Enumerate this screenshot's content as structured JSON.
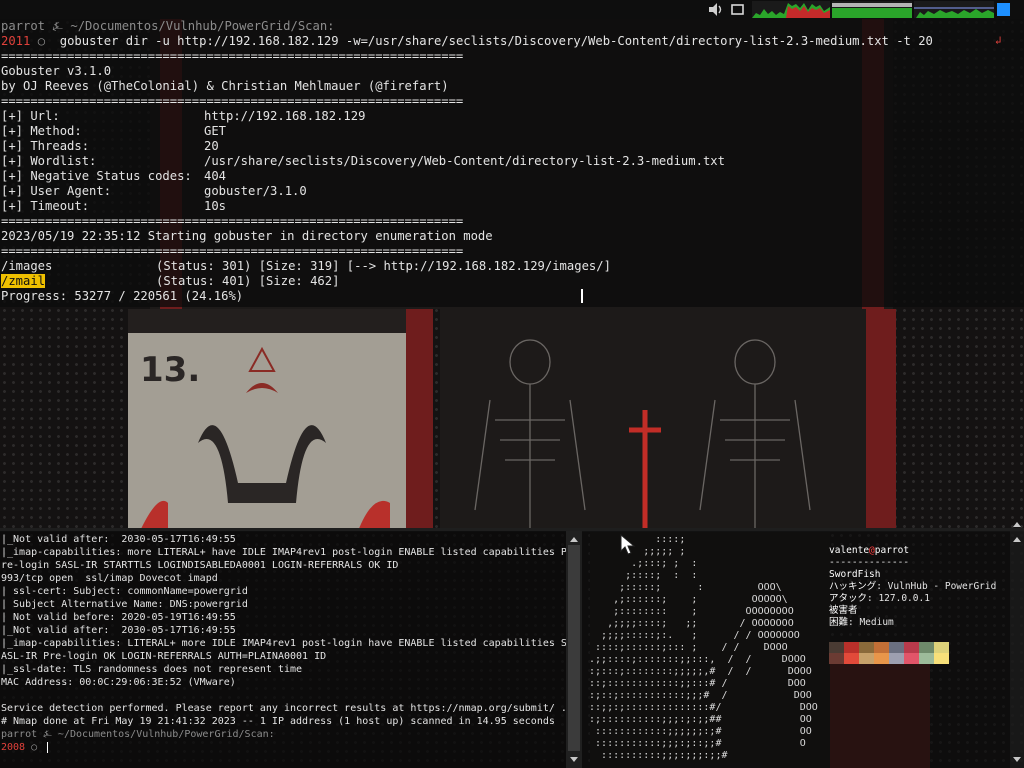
{
  "top_terminal": {
    "prompt_user": "parrot",
    "prompt_symbol": "⍼",
    "prompt_path": "~/Documentos/Vulnhub/PowerGrid/Scan:",
    "command_number": "2011",
    "command_status": "○",
    "command": "gobuster dir -u http://192.168.182.129 -w=/usr/share/seclists/Discovery/Web-Content/directory-list-2.3-medium.txt -t 20",
    "return_marker": "↲",
    "separator": "===============================================================",
    "banner_version": "Gobuster v3.1.0",
    "banner_authors": "by OJ Reeves (@TheColonial) & Christian Mehlmauer (@firefart)",
    "config": [
      {
        "key": "[+] Url:",
        "value": "http://192.168.182.129"
      },
      {
        "key": "[+] Method:",
        "value": "GET"
      },
      {
        "key": "[+] Threads:",
        "value": "20"
      },
      {
        "key": "[+] Wordlist:",
        "value": "/usr/share/seclists/Discovery/Web-Content/directory-list-2.3-medium.txt"
      },
      {
        "key": "[+] Negative Status codes:",
        "value": "404"
      },
      {
        "key": "[+] User Agent:",
        "value": "gobuster/3.1.0"
      },
      {
        "key": "[+] Timeout:",
        "value": "10s"
      }
    ],
    "start_line": "2023/05/19 22:35:12 Starting gobuster in directory enumeration mode",
    "results": [
      {
        "path": "/images",
        "info": "(Status: 301) [Size: 319] [--> http://192.168.182.129/images/]"
      },
      {
        "path": "/zmail",
        "info": "(Status: 401) [Size: 462]"
      }
    ],
    "progress": "Progress: 53277 / 220561 (24.16%)"
  },
  "bottom_left_terminal": {
    "lines": [
      "|_Not valid after:  2030-05-17T16:49:55",
      "|_imap-capabilities: more LITERAL+ have IDLE IMAP4rev1 post-login ENABLE listed capabilities P",
      "re-login SASL-IR STARTTLS LOGINDISABLEDA0001 LOGIN-REFERRALS OK ID",
      "993/tcp open  ssl/imap Dovecot imapd",
      "| ssl-cert: Subject: commonName=powergrid",
      "| Subject Alternative Name: DNS:powergrid",
      "| Not valid before: 2020-05-19T16:49:55",
      "|_Not valid after:  2030-05-17T16:49:55",
      "|_imap-capabilities: LITERAL+ more IDLE IMAP4rev1 post-login have ENABLE listed capabilities S",
      "ASL-IR Pre-login OK LOGIN-REFERRALS AUTH=PLAINA0001 ID",
      "|_ssl-date: TLS randomness does not represent time",
      "MAC Address: 00:0C:29:06:3E:52 (VMware)",
      "",
      "Service detection performed. Please report any incorrect results at https://nmap.org/submit/ .",
      "# Nmap done at Fri May 19 21:41:32 2023 -- 1 IP address (1 host up) scanned in 14.95 seconds"
    ],
    "prompt_user": "parrot",
    "prompt_symbol": "⍼",
    "prompt_path": "~/Documentos/Vulnhub/PowerGrid/Scan:",
    "command_number": "2008",
    "command_status": "○"
  },
  "bottom_right_terminal": {
    "ascii_art": [
      "            ::::;",
      "          ;;;;; ;",
      "        .;:::; ;  :",
      "       ;::::;  :  :",
      "      ;:::::;      :         OOO\\",
      "     ,;::::::;    ;         OOOOO\\",
      "     ;::::::::    ;        OOOOOOOO",
      "    ,;;;;::::;   ;;       / OOOOOOO",
      "   ;;;;:::::;:.   ;      / / OOOOOOO",
      "  ::::;::::::;::: ;    / /    DOOO",
      " .;;::::;:::::::;;:::,  /  /     DOOO",
      " :;:::;::::::::;;;;;,#  /  /      DOOO",
      " ::;::::::::::::;;:::# /          DOO",
      " :;::;:::::::::::;;;#  /           DOO",
      " ::;;:;::::::::::::::#/             DOO",
      " :;::::::::::;;;:;:;;##             OO",
      "  ::::::::::::;;;;;;:;#             OO",
      "  :::::::::::;;;:;::;;#             O",
      "   ::::::::::;;;:;;;:;;#"
    ],
    "neofetch_user": "valente",
    "neofetch_at": "@",
    "neofetch_host": "parrot",
    "neofetch_sep": "--------------",
    "neofetch_title": "SwordFish",
    "info": [
      {
        "key": "ハッキング",
        "value": ": VulnHub - PowerGrid"
      },
      {
        "key": "アタック",
        "value": ": 127.0.0.1"
      },
      {
        "key": "被害者",
        "value": ""
      },
      {
        "key": "困難",
        "value": ": Medium"
      }
    ],
    "palette": [
      "#4a3b33",
      "#b9302a",
      "#8a6a3a",
      "#c26f36",
      "#6a6f80",
      "#b83a4b",
      "#6e8a6a",
      "#ddd27a",
      "#6b3b33",
      "#e24a3a",
      "#c6a16a",
      "#e8964a",
      "#9d9fb0",
      "#e25569",
      "#9dbb9a",
      "#f7e07a"
    ]
  },
  "system_tray": {
    "volume_icon": "volume-icon",
    "window_icon": "window-icon",
    "accent": "#1e90ff"
  }
}
